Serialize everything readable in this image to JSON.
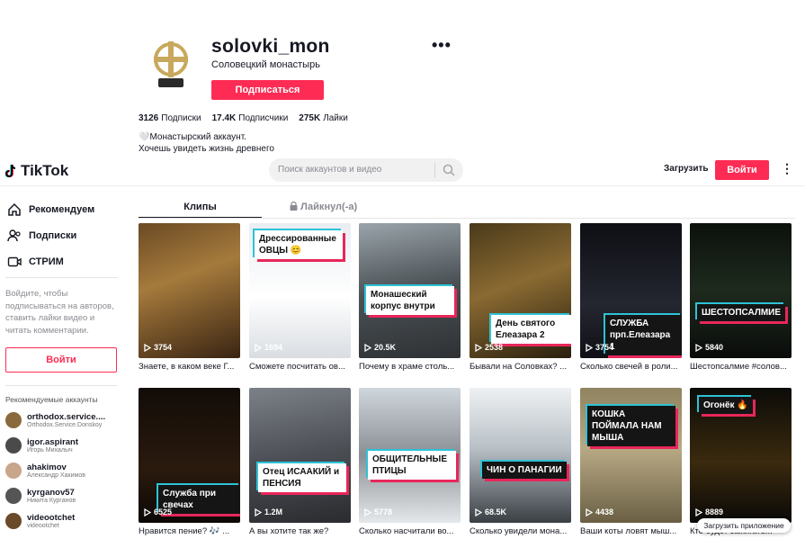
{
  "profile": {
    "username": "solovki_mon",
    "nickname": "Соловецкий монастырь",
    "follow_label": "Подписаться",
    "stats": [
      {
        "value": "3126",
        "label": "Подписки"
      },
      {
        "value": "17.4K",
        "label": "Подписчики"
      },
      {
        "value": "275K",
        "label": "Лайки"
      }
    ],
    "bio_line1": "🤍Монастырский аккаунт.",
    "bio_line2": "Хочешь увидеть жизнь древнего",
    "more_icon": "•••"
  },
  "topbar": {
    "logo_text": "TikTok",
    "search_placeholder": "Поиск аккаунтов и видео",
    "upload_label": "Загрузить",
    "login_label": "Войти",
    "menu_icon": "⋮"
  },
  "sidebar": {
    "nav": [
      {
        "label": "Рекомендуем",
        "icon": "home-icon"
      },
      {
        "label": "Подписки",
        "icon": "users-icon"
      },
      {
        "label": "СТРИМ",
        "icon": "live-icon"
      }
    ],
    "prompt": "Войдите, чтобы подписываться на авторов, ставить лайки видео и читать комментарии.",
    "login_label": "Войти",
    "recommended_title": "Рекомендуемые аккаунты",
    "accounts": [
      {
        "name": "orthodox.service....",
        "sub": "Orthodox.Service.Donskoy",
        "color": "#8a6a3c"
      },
      {
        "name": "igor.aspirant",
        "sub": "Игорь Михалыч",
        "color": "#4a4a4a"
      },
      {
        "name": "ahakimov",
        "sub": "Александр Хакимов",
        "color": "#c9a58a"
      },
      {
        "name": "kyrganov57",
        "sub": "Никита Курганов",
        "color": "#555555"
      },
      {
        "name": "videootchet",
        "sub": "videootchet",
        "color": "#6b4a2a"
      }
    ]
  },
  "tabs": {
    "clips": "Клипы",
    "liked": "Лайкнул(-а)"
  },
  "videos": [
    {
      "views": "3754",
      "caption": "Знаете, в каком веке Г...",
      "label": "",
      "bg": "linear-gradient(160deg,#6b4a24,#a57a3c 40%,#3a2412)"
    },
    {
      "views": "1694",
      "caption": "Сможете посчитать ов...",
      "label": "Дрессированные ОВЦЫ 😊",
      "bg": "linear-gradient(180deg,#e9edf1,#ffffff 55%,#d9dde2)"
    },
    {
      "views": "20.5K",
      "caption": "Почему в храме столь...",
      "label": "Монашеский корпус внутри",
      "bg": "linear-gradient(170deg,#9aa4aa,#4a5054 50%,#2e3134)"
    },
    {
      "views": "2538",
      "caption": "Бывали на Соловках? ...",
      "label": "День святого Елеазара 2",
      "bg": "linear-gradient(160deg,#4a3a1a,#8a6a32 45%,#2a200e)"
    },
    {
      "views": "3754",
      "caption": "Сколько свечей в роли...",
      "label": "СЛУЖБА прп.Елеазара 1",
      "bg": "linear-gradient(180deg,#0e0f14,#242630 60%,#101116)"
    },
    {
      "views": "5840",
      "caption": "Шестопсалмие #солов...",
      "label": "ШЕСТОПСАЛМИЕ",
      "bg": "linear-gradient(180deg,#0c110c,#1e2a1e 50%,#0a0c0a)"
    },
    {
      "views": "6525",
      "caption": "Нравится пение? 🎶 ...",
      "label": "Служба при свечах",
      "bg": "linear-gradient(180deg,#120c08,#2a1a0e 60%,#0c0806)"
    },
    {
      "views": "1.2M",
      "caption": "А вы хотите так же?",
      "label": "Отец ИСААКИЙ и ПЕНСИЯ",
      "bg": "linear-gradient(170deg,#7c8188,#4c4f55 50%,#2a2b2f)"
    },
    {
      "views": "5778",
      "caption": "Сколько насчитали во...",
      "label": "ОБЩИТЕЛЬНЫЕ ПТИЦЫ",
      "bg": "linear-gradient(180deg,#cfd6dc,#8a8f94 50%,#e5e8ea)"
    },
    {
      "views": "68.5K",
      "caption": "Сколько увидели мона...",
      "label": "ЧИН О ПАНАГИИ",
      "bg": "linear-gradient(180deg,#eef1f3,#b8c0c6 45%,#3a3f44)"
    },
    {
      "views": "4438",
      "caption": "Ваши коты ловят мыш...",
      "label": "КОШКА ПОЙМАЛА НАМ МЫША",
      "bg": "linear-gradient(180deg,#8f8360,#b8a984 45%,#6a5f44)"
    },
    {
      "views": "8889",
      "caption": "Кто будет зажигать...",
      "label": "Огонёк 🔥",
      "bg": "linear-gradient(180deg,#0c0b08,#3a2a0e 55%,#0a0806)"
    }
  ],
  "download_app": "Загрузить приложение"
}
